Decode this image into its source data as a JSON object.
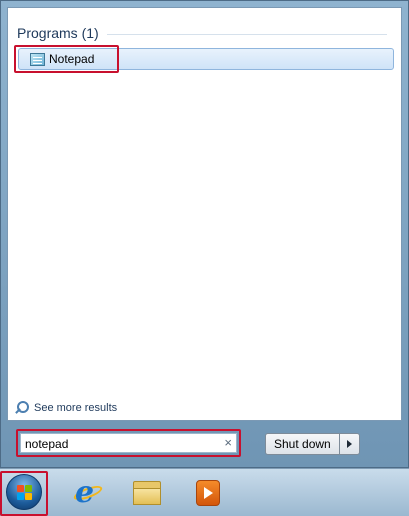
{
  "start_menu": {
    "results_header": "Programs (1)",
    "results": [
      {
        "label": "Notepad",
        "icon": "notepad-icon"
      }
    ],
    "see_more_label": "See more results",
    "search": {
      "value": "notepad",
      "clear_symbol": "×"
    },
    "shutdown_label": "Shut down"
  },
  "taskbar": {
    "items": [
      {
        "name": "start-button",
        "icon": "windows-logo-icon"
      },
      {
        "name": "internet-explorer",
        "icon": "internet-explorer-icon"
      },
      {
        "name": "windows-explorer",
        "icon": "folder-icon"
      },
      {
        "name": "media-player",
        "icon": "media-player-icon"
      }
    ]
  },
  "colors": {
    "highlight_outline": "#c8102e",
    "section_title": "#1e395b",
    "selection_fill": "#cfe3f8"
  }
}
